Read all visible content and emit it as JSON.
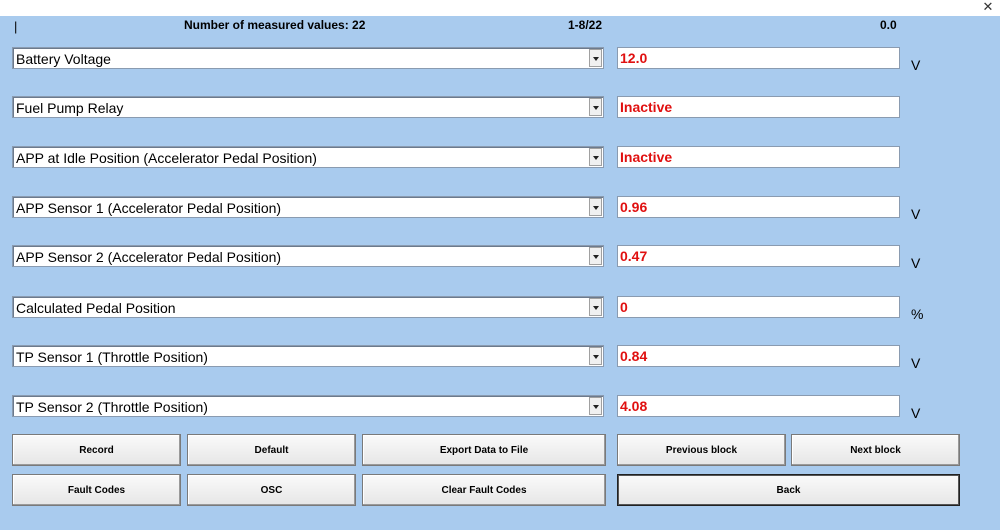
{
  "window": {
    "close_glyph": "✕"
  },
  "header": {
    "cursor_glyph": "|",
    "measured_values_label": "Number of measured values: 22",
    "page_range": "1-8/22",
    "counter": "0.0"
  },
  "rows": [
    {
      "label": "Battery Voltage",
      "value": "12.0",
      "unit": "V"
    },
    {
      "label": "Fuel Pump Relay",
      "value": "Inactive",
      "unit": ""
    },
    {
      "label": "APP at Idle Position (Accelerator Pedal Position)",
      "value": "Inactive",
      "unit": ""
    },
    {
      "label": "APP Sensor 1 (Accelerator Pedal Position)",
      "value": "0.96",
      "unit": "V"
    },
    {
      "label": "APP Sensor 2 (Accelerator Pedal Position)",
      "value": "0.47",
      "unit": "V"
    },
    {
      "label": "Calculated Pedal Position",
      "value": "0",
      "unit": "%"
    },
    {
      "label": "TP Sensor 1 (Throttle Position)",
      "value": "0.84",
      "unit": "V"
    },
    {
      "label": "TP Sensor 2 (Throttle Position)",
      "value": "4.08",
      "unit": "V"
    }
  ],
  "buttons": {
    "record": "Record",
    "default": "Default",
    "export": "Export Data to File",
    "previous_block": "Previous block",
    "next_block": "Next block",
    "fault_codes": "Fault Codes",
    "osc": "OSC",
    "clear_fault_codes": "Clear Fault Codes",
    "back": "Back"
  },
  "colors": {
    "background": "#a9cbee",
    "value_text": "#e01010"
  }
}
